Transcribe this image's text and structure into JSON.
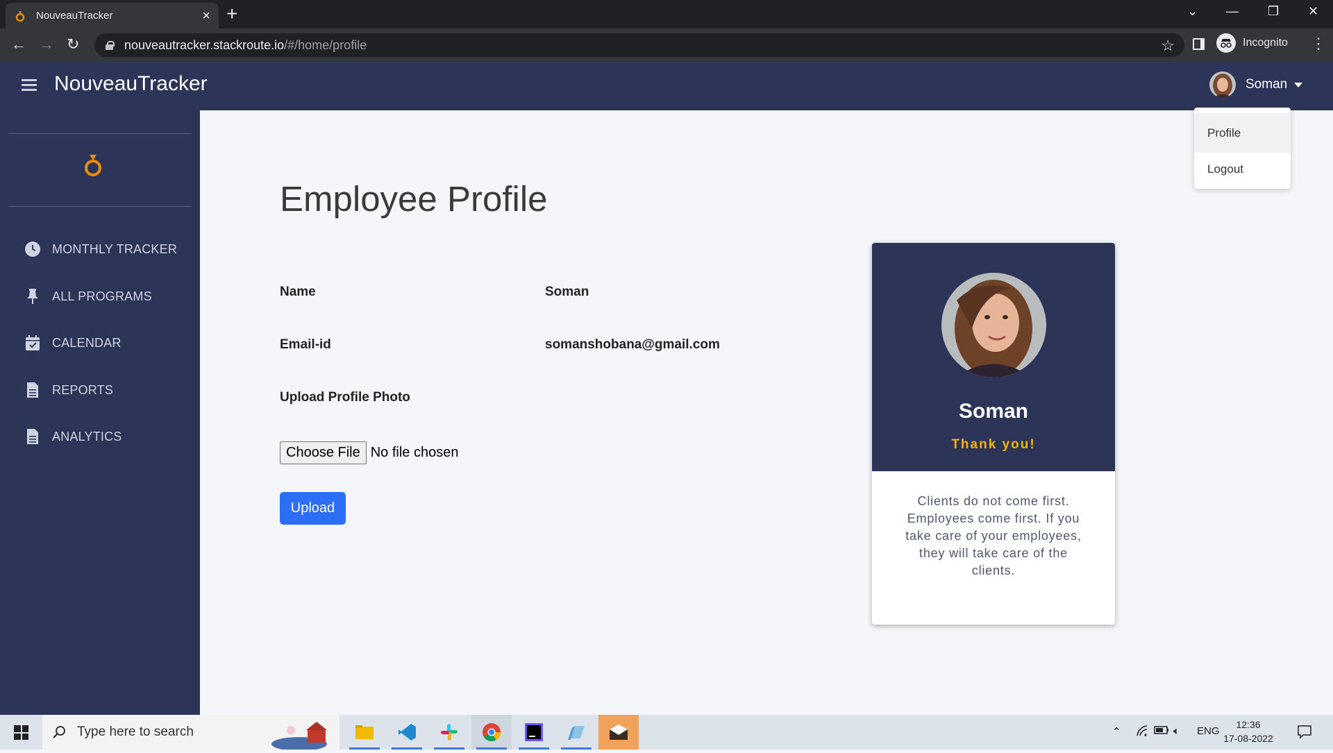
{
  "browser": {
    "tab_title": "NouveauTracker",
    "url_host": "nouveautracker.stackroute.io",
    "url_path": "/#/home/profile",
    "incognito_label": "Incognito"
  },
  "app": {
    "brand": "NouveauTracker",
    "user_name": "Soman",
    "sidebar": {
      "items": [
        {
          "label": "MONTHLY TRACKER",
          "icon": "clock-icon"
        },
        {
          "label": "ALL PROGRAMS",
          "icon": "pin-icon"
        },
        {
          "label": "CALENDAR",
          "icon": "calendar-icon"
        },
        {
          "label": "REPORTS",
          "icon": "document-icon"
        },
        {
          "label": "ANALYTICS",
          "icon": "document-icon"
        }
      ]
    },
    "dropdown": {
      "profile": "Profile",
      "logout": "Logout"
    },
    "profile": {
      "title": "Employee Profile",
      "name_label": "Name",
      "name_value": "Soman",
      "email_label": "Email-id",
      "email_value": "somanshobana@gmail.com",
      "upload_label": "Upload Profile Photo",
      "choose_file": "Choose File",
      "no_file": "No file chosen",
      "upload_button": "Upload"
    },
    "card": {
      "name": "Soman",
      "thanks": "Thank you!",
      "quote": "Clients do not come first. Employees come first. If you take care of your employees, they will take care of the clients."
    },
    "colors": {
      "navy": "#2c3557",
      "accent": "#f5b400",
      "primary_button": "#2d6ef7"
    }
  },
  "taskbar": {
    "search_placeholder": "Type here to search",
    "language": "ENG",
    "time": "12:36",
    "date": "17-08-2022"
  }
}
